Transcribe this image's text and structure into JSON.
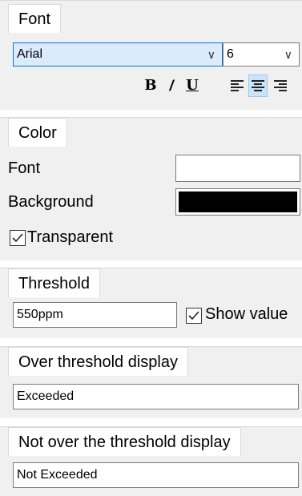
{
  "font_panel": {
    "tab_label": "Font",
    "font_family": "Arial",
    "font_size": "6",
    "bold_label": "B",
    "italic_label": "/",
    "underline_label": "U",
    "align_active": "center"
  },
  "color_panel": {
    "tab_label": "Color",
    "font_label": "Font",
    "background_label": "Background",
    "transparent_label": "Transparent",
    "transparent_checked": true,
    "font_color": "#ffffff",
    "background_color": "#000000"
  },
  "threshold_panel": {
    "tab_label": "Threshold",
    "value": "550ppm",
    "show_value_label": "Show value",
    "show_value_checked": true
  },
  "over_panel": {
    "tab_label": "Over threshold display",
    "value": "Exceeded"
  },
  "not_over_panel": {
    "tab_label": "Not over the threshold display",
    "value": "Not Exceeded"
  }
}
